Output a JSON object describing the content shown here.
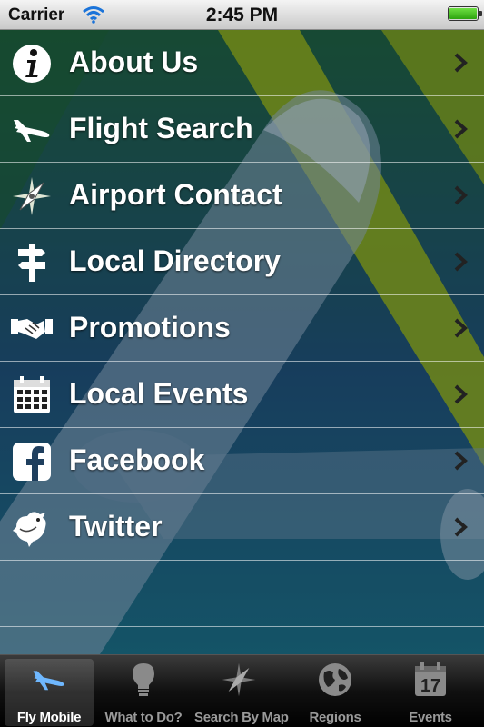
{
  "status": {
    "carrier": "Carrier",
    "time": "2:45 PM"
  },
  "menu": {
    "items": [
      {
        "label": "About Us",
        "icon": "info-icon"
      },
      {
        "label": "Flight Search",
        "icon": "airplane-icon"
      },
      {
        "label": "Airport Contact",
        "icon": "compass-icon"
      },
      {
        "label": "Local Directory",
        "icon": "signpost-icon"
      },
      {
        "label": "Promotions",
        "icon": "handshake-icon"
      },
      {
        "label": "Local Events",
        "icon": "calendar-icon"
      },
      {
        "label": "Facebook",
        "icon": "facebook-icon"
      },
      {
        "label": "Twitter",
        "icon": "twitter-bird-icon"
      }
    ]
  },
  "tabs": [
    {
      "label": "Fly Mobile",
      "icon": "airplane-icon",
      "active": true
    },
    {
      "label": "What to Do?",
      "icon": "lightbulb-icon"
    },
    {
      "label": "Search By Map",
      "icon": "compass-icon"
    },
    {
      "label": "Regions",
      "icon": "globe-icon"
    },
    {
      "label": "Events",
      "icon": "calendar-icon",
      "date": "17"
    }
  ],
  "colors": {
    "accent_tab_icon": "#6fb8ff",
    "stripe_yellow": "#b8c400"
  }
}
